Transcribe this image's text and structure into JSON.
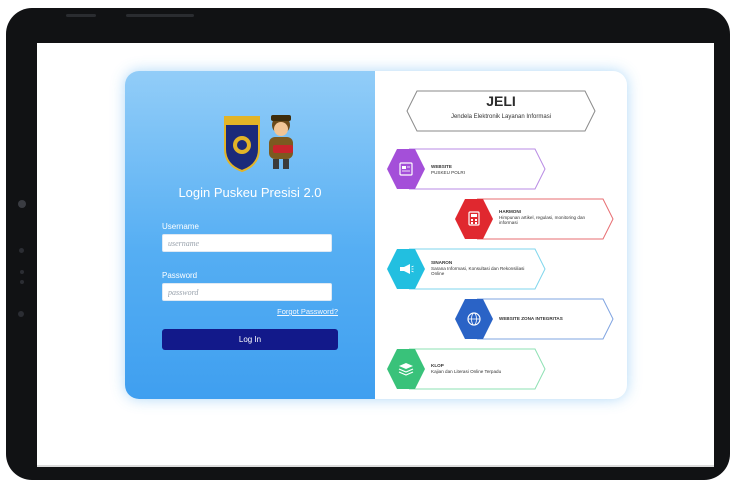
{
  "login": {
    "title": "Login Puskeu Presisi 2.0",
    "username_label": "Username",
    "username_placeholder": "username",
    "password_label": "Password",
    "password_placeholder": "password",
    "forgot_link": "Forgot Password?",
    "login_button": "Log In",
    "emblem_text": "KEUANGAN"
  },
  "jeli": {
    "title": "JELI",
    "subtitle": "Jendela Elektronik Layanan Informasi"
  },
  "services": [
    {
      "name": "WEBSITE",
      "desc": "PUSKEU POLRI",
      "color": "#a44fd9",
      "border": "#b88be4",
      "icon": "website-icon"
    },
    {
      "name": "HARMONI",
      "desc": "Himpunan artikel, regulasi, monitoring dan informasi",
      "color": "#e0282f",
      "border": "#e76d72",
      "icon": "calculator-icon"
    },
    {
      "name": "SINARON",
      "desc": "Sarana Informasi, Konsultasi dan Rekonsiliasi Online",
      "color": "#22bfe0",
      "border": "#7fd6ec",
      "icon": "megaphone-icon"
    },
    {
      "name": "WEBSITE ZONA INTEGRITAS",
      "desc": "",
      "color": "#2a63c6",
      "border": "#7fa4e0",
      "icon": "globe-icon"
    },
    {
      "name": "KLOP",
      "desc": "Kajian dan Literasi Online Terpadu",
      "color": "#39c27a",
      "border": "#8ee0b3",
      "icon": "books-icon"
    }
  ]
}
